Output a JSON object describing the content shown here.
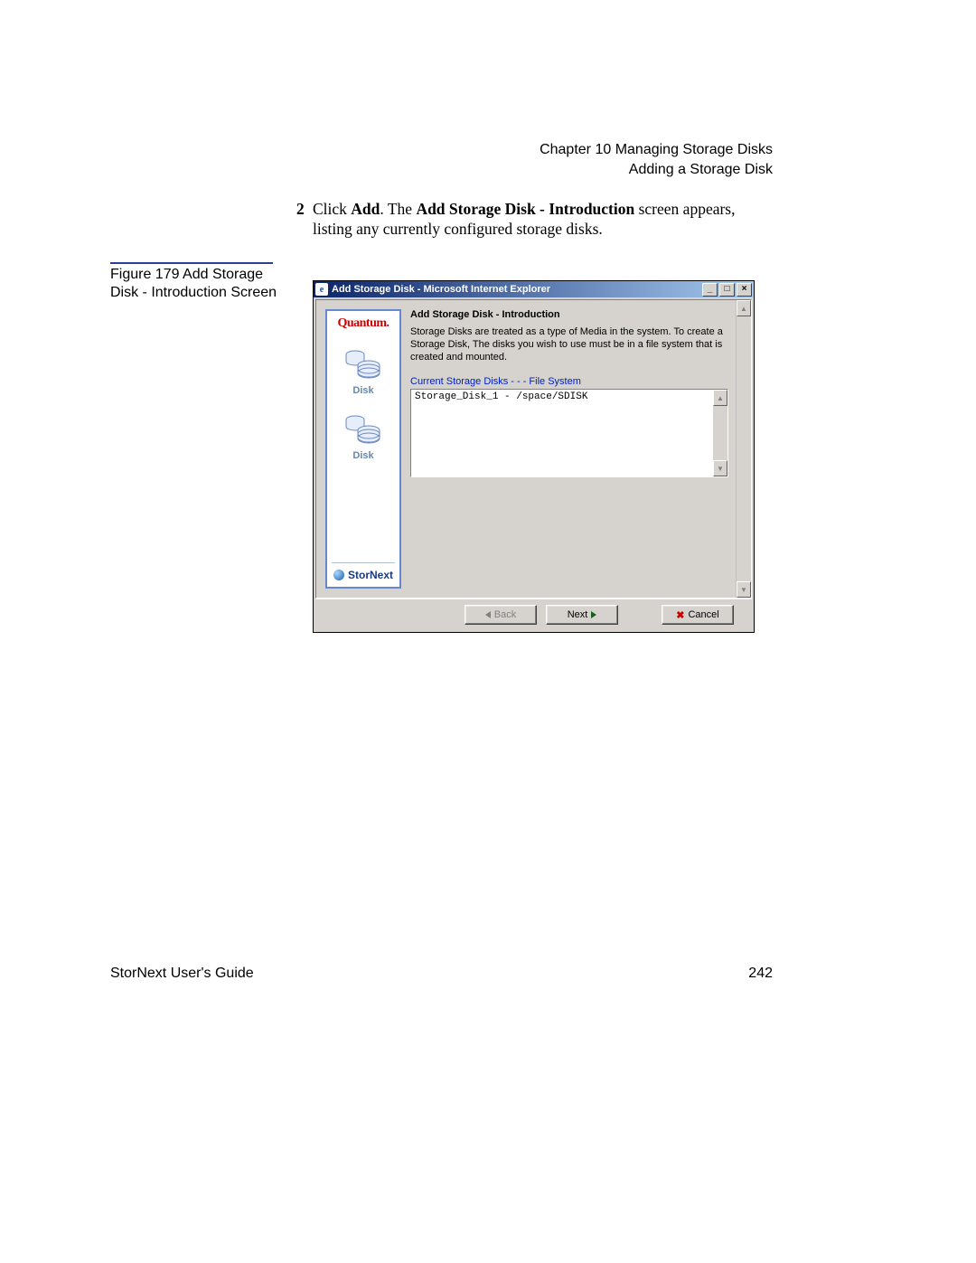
{
  "header": {
    "chapter": "Chapter 10  Managing Storage Disks",
    "section": "Adding a Storage Disk"
  },
  "step": {
    "number": "2",
    "prefix": "Click ",
    "bold1": "Add",
    "mid": ". The ",
    "bold2": "Add Storage Disk - Introduction",
    "suffix": " screen appears, listing any currently configured storage disks."
  },
  "caption": "Figure 179  Add Storage Disk - Introduction Screen",
  "footer": {
    "guide": "StorNext User's Guide",
    "page": "242"
  },
  "window": {
    "title": "Add Storage Disk - Microsoft Internet Explorer",
    "ie_glyph": "e",
    "ctrl": {
      "min": "_",
      "max": "□",
      "close": "×",
      "up": "▲",
      "down": "▼"
    },
    "sidebar": {
      "brand": "Quantum.",
      "disk_label": "Disk",
      "product": "StorNext"
    },
    "main": {
      "title": "Add Storage Disk - Introduction",
      "desc": "Storage Disks are treated as a type of Media in the system. To create a Storage Disk, The disks you wish to use must be in a file system that is created and mounted.",
      "list_label": "Current Storage Disks - - - File System",
      "list_item": "Storage_Disk_1 - /space/SDISK"
    },
    "buttons": {
      "back": "Back",
      "next": "Next",
      "cancel": "Cancel"
    }
  }
}
